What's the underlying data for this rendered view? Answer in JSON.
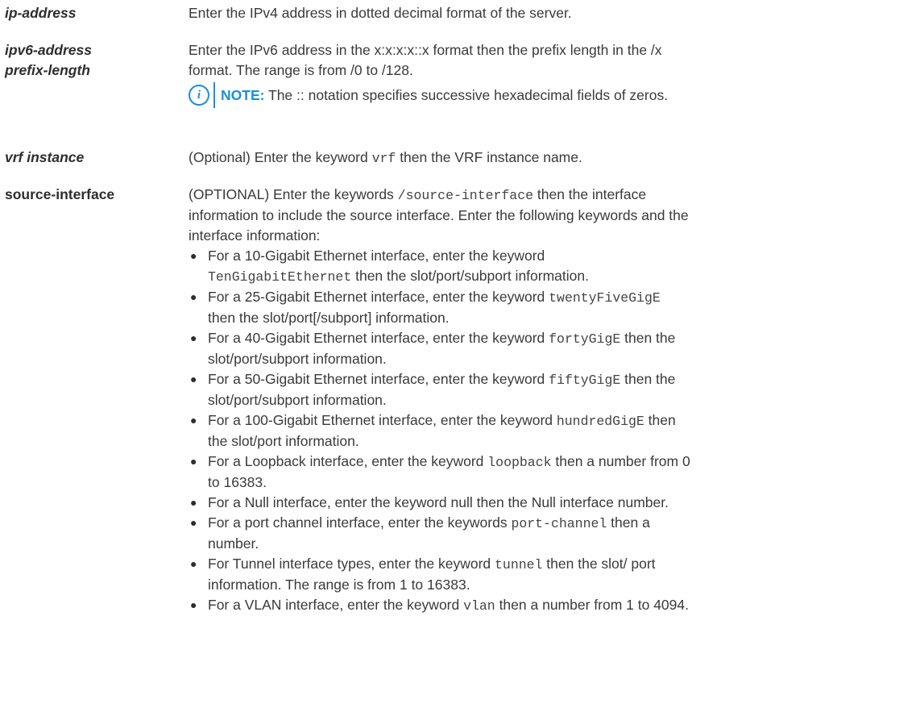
{
  "rows": [
    {
      "term": "ip-address",
      "desc": "Enter the IPv4 address in dotted decimal format of the server."
    },
    {
      "term_line1": "ipv6-address",
      "term_line2": "prefix-length",
      "desc_line1": "Enter the IPv6 address in the x:x:x:x::x format then the prefix length in the /x",
      "desc_line2": "format. The range is from /0 to /128.",
      "note_label": "NOTE:",
      "note_text": " The :: notation specifies successive hexadecimal fields of zeros."
    },
    {
      "term": "vrf instance",
      "desc_pre": "(Optional) Enter the keyword ",
      "desc_code": "vrf",
      "desc_post": " then the VRF instance name."
    },
    {
      "term": "source-interface",
      "desc_l1_pre": "(OPTIONAL) Enter the keywords ",
      "desc_l1_code": "/source-interface",
      "desc_l1_post": " then the interface",
      "desc_l2": "information to include the source interface. Enter the following keywords and the",
      "desc_l3": "interface information:"
    }
  ],
  "bullets": [
    {
      "l1_pre": "For a 10-Gigabit Ethernet interface, enter the keyword",
      "l2_code": "TenGigabitEthernet",
      "l2_post": " then the slot/port/subport information."
    },
    {
      "l1_pre": "For a 25-Gigabit Ethernet interface, enter the keyword ",
      "l1_code": "twentyFiveGigE",
      "l2": "then the slot/port[/subport] information."
    },
    {
      "l1_pre": "For a 40-Gigabit Ethernet interface, enter the keyword ",
      "l1_code": "fortyGigE",
      "l1_post": " then the",
      "l2": "slot/port/subport information."
    },
    {
      "l1_pre": "For a 50-Gigabit Ethernet interface, enter the keyword ",
      "l1_code": "fiftyGigE",
      "l1_post": " then the",
      "l2": "slot/port/subport information."
    },
    {
      "l1_pre": "For a 100-Gigabit Ethernet interface, enter the keyword ",
      "l1_code": "hundredGigE",
      "l1_post": " then",
      "l2": "the slot/port information."
    },
    {
      "l1_pre": "For a Loopback interface, enter the keyword ",
      "l1_code": "loopback",
      "l1_post": " then a number from 0",
      "l2": "to 16383."
    },
    {
      "l1_pre": "For a Null interface, enter the keyword null then the Null interface number."
    },
    {
      "l1_pre": "For a port channel interface, enter the keywords ",
      "l1_code": "port-channel",
      "l1_post": " then a",
      "l2": "number."
    },
    {
      "l1_pre": "For Tunnel interface types, enter the keyword ",
      "l1_code": "tunnel",
      "l1_post": " then the slot/ port",
      "l2": "information. The range is from 1 to 16383."
    },
    {
      "l1_pre": "For a VLAN interface, enter the keyword ",
      "l1_code": "vlan",
      "l1_post": " then a number from 1 to 4094."
    }
  ],
  "bullet_glyph": "●",
  "note_icon_glyph": "i",
  "colors": {
    "accent": "#1a8fd8",
    "text": "#3a3a3a",
    "term": "#2d2d2d"
  }
}
